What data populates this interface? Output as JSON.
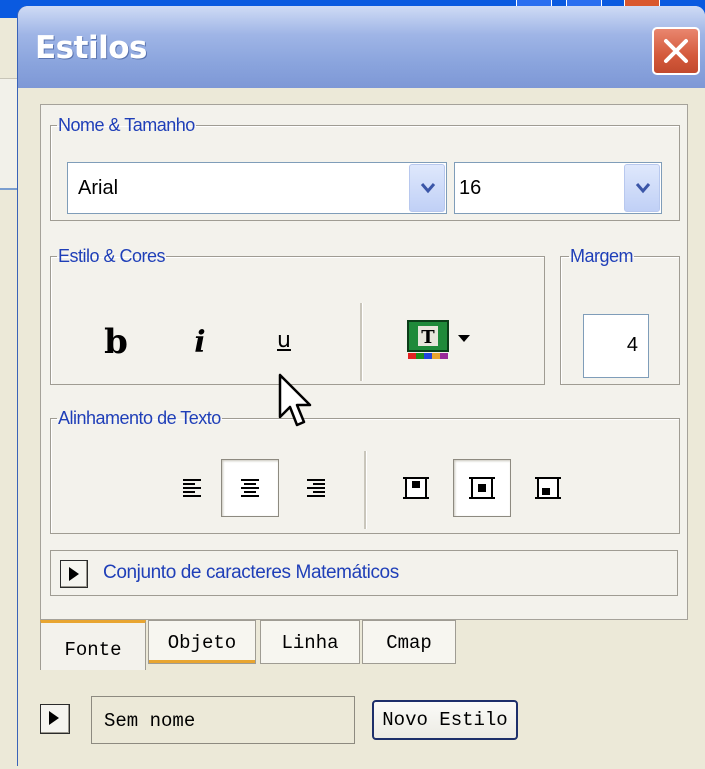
{
  "window": {
    "title": "Estilos"
  },
  "name_size": {
    "legend": "Nome & Tamanho",
    "font_value": "Arial",
    "size_value": "16"
  },
  "style_colors": {
    "legend": "Estilo & Cores",
    "bold": "b",
    "italic": "i",
    "underline": "u",
    "text_color_icon_letter": "T"
  },
  "margin": {
    "legend": "Margem",
    "value": "4"
  },
  "alignment": {
    "legend": "Alinhamento de Texto",
    "horizontal_selected": "center",
    "vertical_selected": "middle"
  },
  "math_charset": {
    "label": "Conjunto de caracteres Matemáticos"
  },
  "tabs": [
    {
      "label": "Fonte",
      "active": true
    },
    {
      "label": "Objeto",
      "active": false
    },
    {
      "label": "Linha",
      "active": false
    },
    {
      "label": "Cmap",
      "active": false
    }
  ],
  "footer": {
    "style_name": "Sem nome",
    "new_style_label": "Novo Estilo"
  },
  "colors": {
    "legend_text": "#1f3fb8",
    "tab_accent": "#e8a530",
    "close_button": "#d45a3c",
    "titlebar": "#8aa4dd"
  }
}
